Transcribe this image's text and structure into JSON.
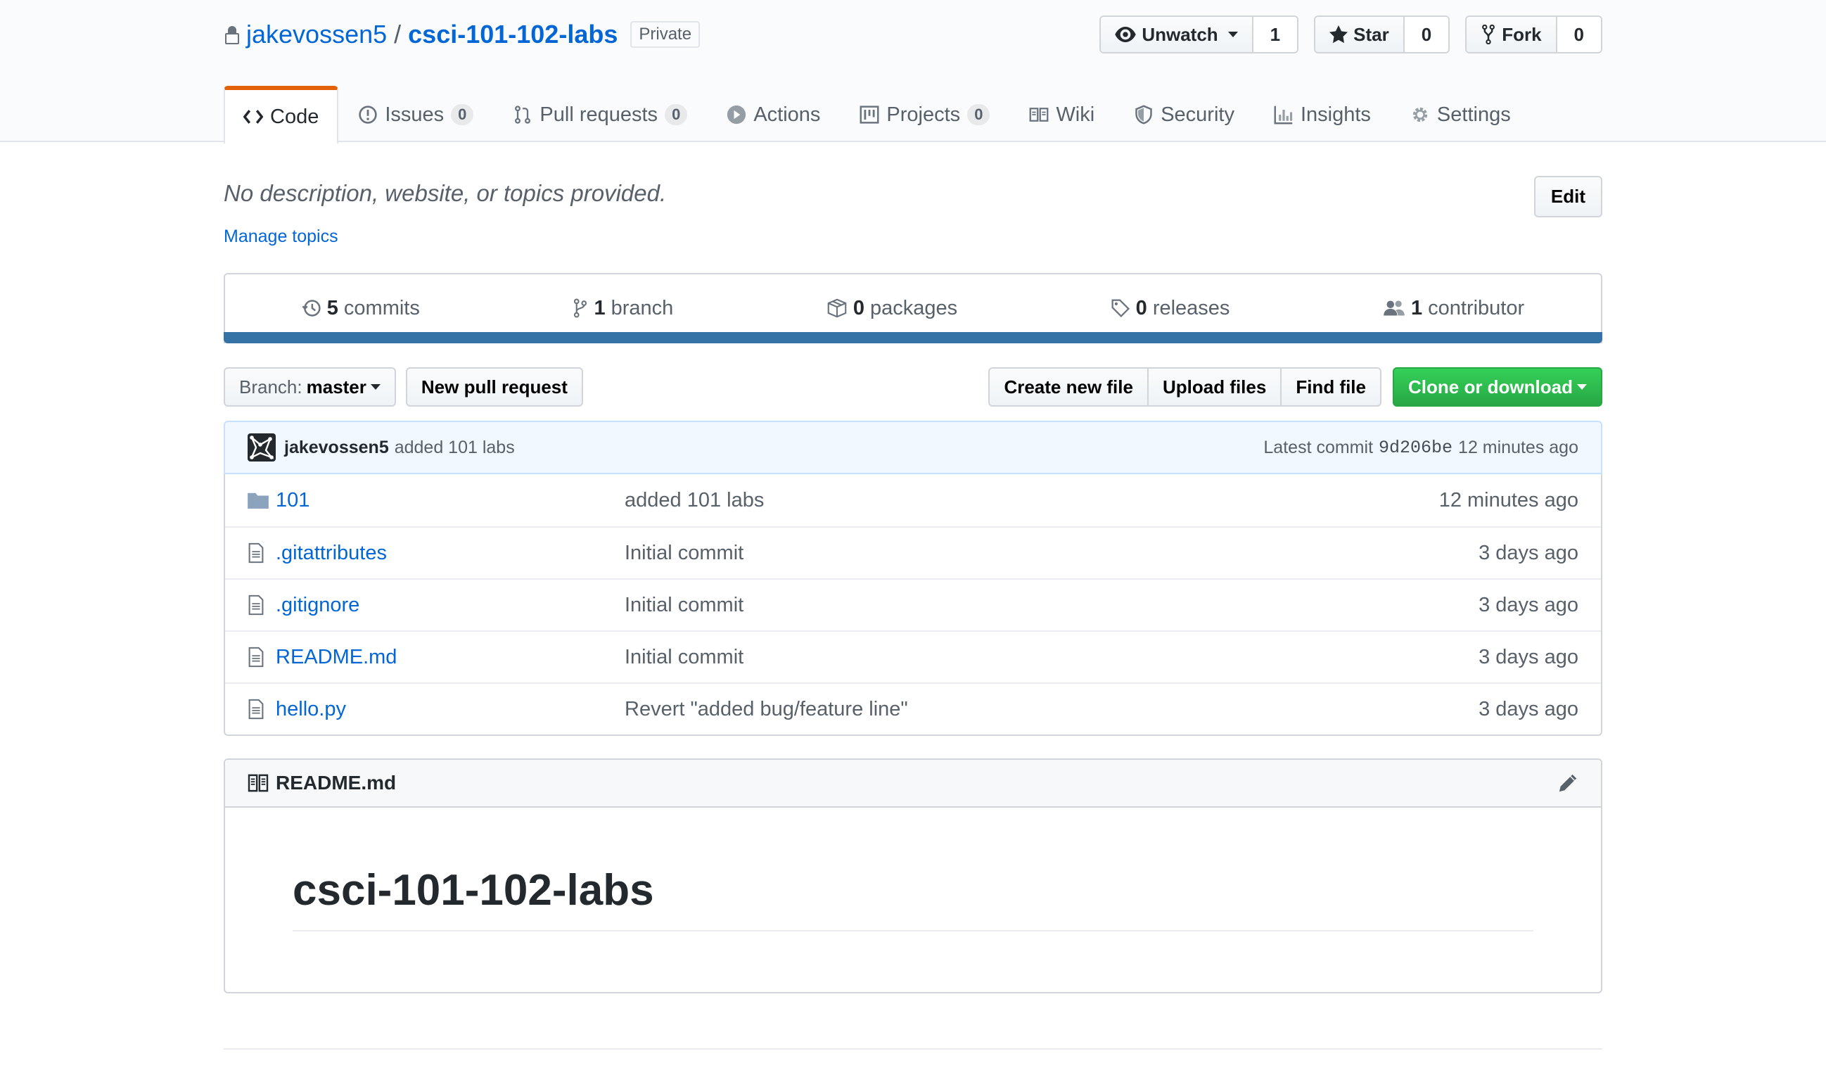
{
  "repo": {
    "owner": "jakevossen5",
    "separator": "/",
    "name": "csci-101-102-labs",
    "visibility": "Private"
  },
  "actions": {
    "watch": {
      "label": "Unwatch",
      "count": "1"
    },
    "star": {
      "label": "Star",
      "count": "0"
    },
    "fork": {
      "label": "Fork",
      "count": "0"
    }
  },
  "tabs": [
    {
      "label": "Code",
      "icon": "code-icon"
    },
    {
      "label": "Issues",
      "count": "0",
      "icon": "issue-icon"
    },
    {
      "label": "Pull requests",
      "count": "0",
      "icon": "pull-request-icon"
    },
    {
      "label": "Actions",
      "icon": "play-icon"
    },
    {
      "label": "Projects",
      "count": "0",
      "icon": "project-icon"
    },
    {
      "label": "Wiki",
      "icon": "book-icon"
    },
    {
      "label": "Security",
      "icon": "shield-icon"
    },
    {
      "label": "Insights",
      "icon": "graph-icon"
    },
    {
      "label": "Settings",
      "icon": "gear-icon"
    }
  ],
  "description": "No description, website, or topics provided.",
  "edit_label": "Edit",
  "manage_topics": "Manage topics",
  "summary": {
    "commits": {
      "num": "5",
      "label": "commits"
    },
    "branch": {
      "num": "1",
      "label": "branch"
    },
    "packages": {
      "num": "0",
      "label": "packages"
    },
    "releases": {
      "num": "0",
      "label": "releases"
    },
    "contributor": {
      "num": "1",
      "label": "contributor"
    }
  },
  "language_color": "#3572a5",
  "file_nav": {
    "branch_prefix": "Branch:",
    "branch_name": "master",
    "new_pr": "New pull request",
    "create_file": "Create new file",
    "upload_files": "Upload files",
    "find_file": "Find file",
    "clone": "Clone or download"
  },
  "latest_commit": {
    "author": "jakevossen5",
    "message": "added 101 labs",
    "prefix": "Latest commit",
    "sha": "9d206be",
    "age": "12 minutes ago"
  },
  "files": [
    {
      "type": "folder",
      "name": "101",
      "message": "added 101 labs",
      "age": "12 minutes ago"
    },
    {
      "type": "file",
      "name": ".gitattributes",
      "message": "Initial commit",
      "age": "3 days ago"
    },
    {
      "type": "file",
      "name": ".gitignore",
      "message": "Initial commit",
      "age": "3 days ago"
    },
    {
      "type": "file",
      "name": "README.md",
      "message": "Initial commit",
      "age": "3 days ago"
    },
    {
      "type": "file",
      "name": "hello.py",
      "message": "Revert \"added bug/feature line\"",
      "age": "3 days ago"
    }
  ],
  "readme": {
    "filename": "README.md",
    "heading": "csci-101-102-labs"
  }
}
